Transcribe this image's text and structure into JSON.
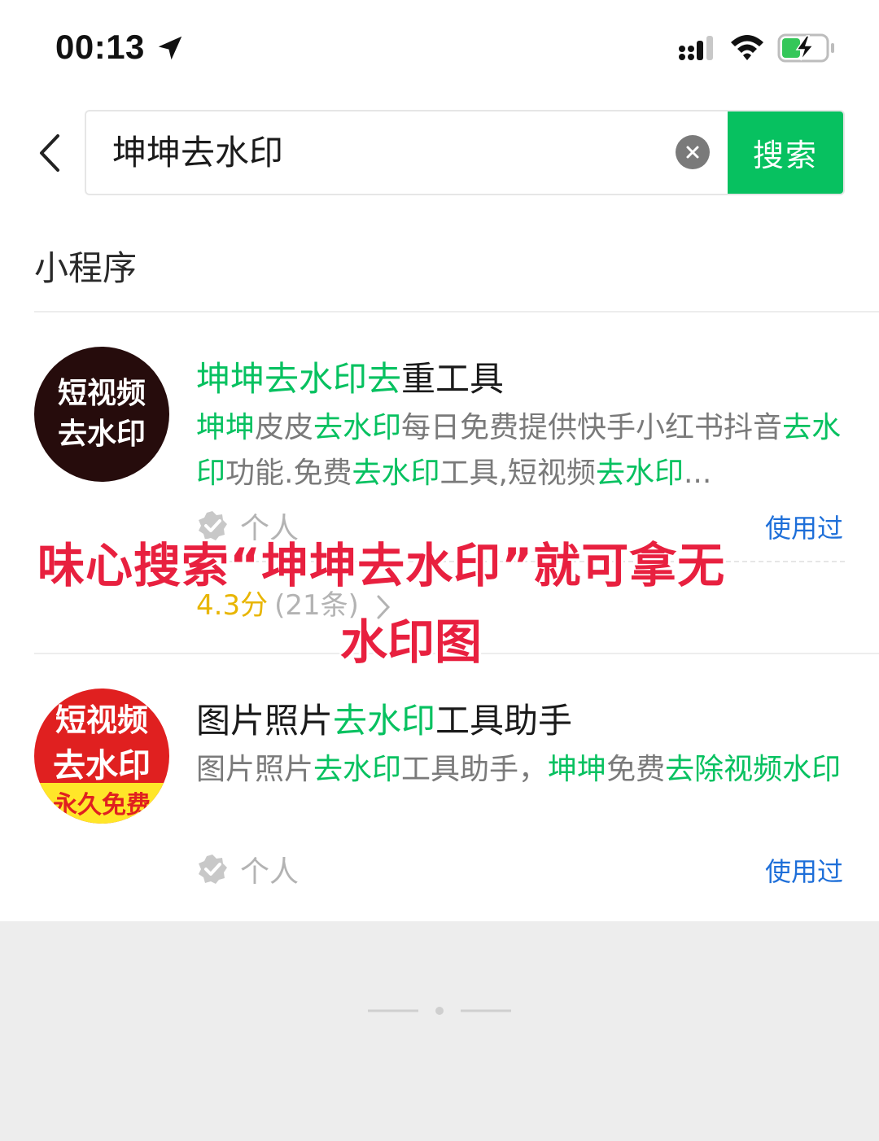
{
  "status_bar": {
    "time": "00:13",
    "icons": [
      "location-arrow-icon",
      "cellular-signal-icon",
      "wifi-icon",
      "battery-charging-icon"
    ]
  },
  "search": {
    "query": "坤坤去水印",
    "button_label": "搜索",
    "icons": [
      "back-chevron-icon",
      "clear-icon"
    ]
  },
  "section": {
    "title": "小程序"
  },
  "results": [
    {
      "avatar_text": [
        "短视频",
        "去水印"
      ],
      "title_hl": "坤坤去水印去",
      "title_rest": "重工具",
      "desc_parts": [
        {
          "text": "坤坤",
          "hl": true
        },
        {
          "text": "皮皮",
          "hl": false
        },
        {
          "text": "去水印",
          "hl": true
        },
        {
          "text": "每日免费提供快手小红书抖音",
          "hl": false
        },
        {
          "text": "去水印",
          "hl": true
        },
        {
          "text": "功能.免费",
          "hl": false
        },
        {
          "text": "去水印",
          "hl": true
        },
        {
          "text": "工具,短视频",
          "hl": false
        },
        {
          "text": "去水印",
          "hl": true
        },
        {
          "text": "...",
          "hl": false
        }
      ],
      "owner_type": "个人",
      "used_label": "使用过",
      "rating_score": "4.3分",
      "rating_count": "(21条)"
    },
    {
      "avatar_text": [
        "短视频",
        "去水印",
        "永久免费"
      ],
      "title_pre": "图片照片",
      "title_hl": "去水印",
      "title_rest": "工具助手",
      "desc_parts": [
        {
          "text": "图片照片",
          "hl": false
        },
        {
          "text": "去水印",
          "hl": true
        },
        {
          "text": "工具助手，",
          "hl": false
        },
        {
          "text": "坤坤",
          "hl": true
        },
        {
          "text": "免费",
          "hl": false
        },
        {
          "text": "去除视频",
          "hl": true
        },
        {
          "text": "水印",
          "hl": true
        }
      ],
      "owner_type": "个人",
      "used_label": "使用过"
    }
  ],
  "overlay": {
    "line1": "味心搜索“坤坤去水印”就可拿无",
    "line2": "水印图"
  },
  "colors": {
    "accent_green": "#07c160",
    "link_blue": "#1e6fd9",
    "rating_yellow": "#e8b500",
    "overlay_red": "#e8203f"
  }
}
